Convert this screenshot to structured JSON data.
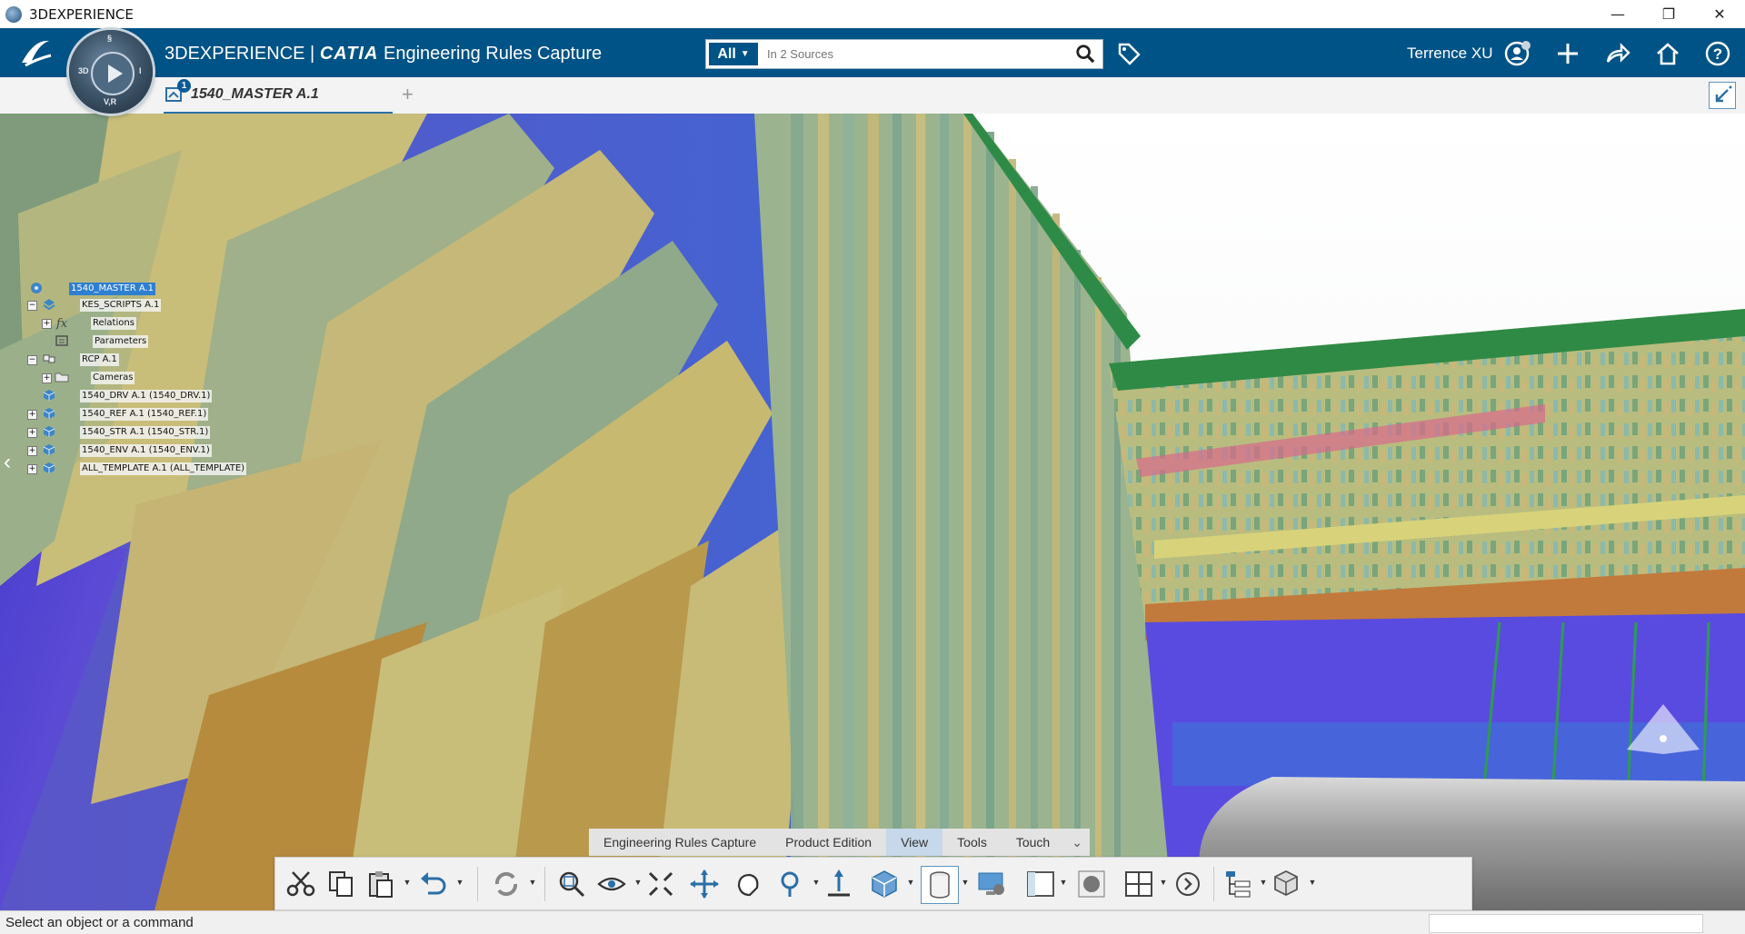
{
  "window": {
    "title": "3DEXPERIENCE",
    "controls": [
      "minimize",
      "restore",
      "close"
    ]
  },
  "topbar": {
    "brand": "3D",
    "title_prefix": "3DEXPERIENCE | ",
    "title_product": "CATIA",
    "title_app": " Engineering Rules Capture",
    "search": {
      "scope": "All",
      "placeholder": "In 2 Sources"
    },
    "user": "Terrence XU",
    "compass_labels": {
      "left": "3D",
      "bottom": "V,R",
      "right": "I",
      "top": "§"
    }
  },
  "tabs": [
    {
      "label": "1540_MASTER A.1",
      "badge": "1"
    }
  ],
  "tree": [
    {
      "label": "1540_MASTER A.1",
      "selected": true,
      "expander": "",
      "icon": "product-root-icon"
    },
    {
      "label": "KES_SCRIPTS A.1",
      "selected": false,
      "expander": "−",
      "icon": "knowledge-set-icon"
    },
    {
      "label": "Relations",
      "selected": false,
      "expander": "+",
      "icon": "relations-icon"
    },
    {
      "label": "Parameters",
      "selected": false,
      "expander": "",
      "icon": "parameters-icon"
    },
    {
      "label": "RCP A.1",
      "selected": false,
      "expander": "−",
      "icon": "product-icon"
    },
    {
      "label": "Cameras",
      "selected": false,
      "expander": "+",
      "icon": "folder-icon"
    },
    {
      "label": "1540_DRV A.1 (1540_DRV.1)",
      "selected": false,
      "expander": "",
      "icon": "part-icon"
    },
    {
      "label": "1540_REF A.1 (1540_REF.1)",
      "selected": false,
      "expander": "+",
      "icon": "part-icon"
    },
    {
      "label": "1540_STR A.1 (1540_STR.1)",
      "selected": false,
      "expander": "+",
      "icon": "part-icon"
    },
    {
      "label": "1540_ENV A.1 (1540_ENV.1)",
      "selected": false,
      "expander": "+",
      "icon": "part-icon"
    },
    {
      "label": "ALL_TEMPLATE A.1 (ALL_TEMPLATE)",
      "selected": false,
      "expander": "+",
      "icon": "part-icon"
    }
  ],
  "section_tabs": [
    "Engineering Rules Capture",
    "Product Edition",
    "View",
    "Tools",
    "Touch"
  ],
  "active_section": "View",
  "action_bar": [
    "cut-icon",
    "copy-icon",
    "paste-icon",
    "undo-icon",
    "update-icon",
    "zoom-area-icon",
    "fly-view-icon",
    "fit-all-icon",
    "pan-icon",
    "rotate-icon",
    "zoom-icon",
    "normal-view-icon",
    "iso-view-icon",
    "render-style-icon",
    "ambience-icon",
    "view-mode-icon",
    "shading-icon",
    "multi-view-icon",
    "next-icon",
    "tree-display-icon",
    "compass-icon"
  ],
  "status": {
    "message": "Select an object or a command"
  },
  "colors": {
    "brand_blue": "#005386",
    "selection_blue": "#2f7fd0",
    "active_section": "#c6d8ea"
  }
}
